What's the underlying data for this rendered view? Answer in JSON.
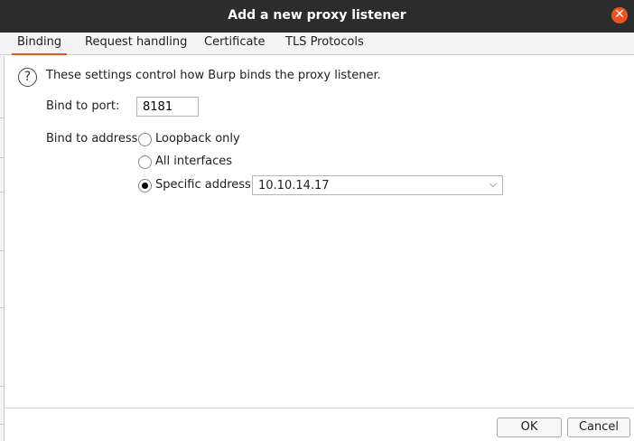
{
  "window": {
    "title": "Add a new proxy listener",
    "close_glyph": "✕"
  },
  "tabs": [
    {
      "label": "Binding",
      "active": true
    },
    {
      "label": "Request handling",
      "active": false
    },
    {
      "label": "Certificate",
      "active": false
    },
    {
      "label": "TLS Protocols",
      "active": false
    }
  ],
  "binding": {
    "help_glyph": "?",
    "info": "These settings control how Burp binds the proxy listener.",
    "port_label": "Bind to port:",
    "port_value": "8181",
    "address_label": "Bind to address:",
    "options": [
      {
        "label": "Loopback only",
        "selected": false
      },
      {
        "label": "All interfaces",
        "selected": false
      },
      {
        "label": "Specific address:",
        "selected": true
      }
    ],
    "specific_address": "10.10.14.17"
  },
  "footer": {
    "ok_label": "OK",
    "cancel_label": "Cancel"
  },
  "colors": {
    "titlebar": "#2c2c2c",
    "accent": "#e95420"
  }
}
